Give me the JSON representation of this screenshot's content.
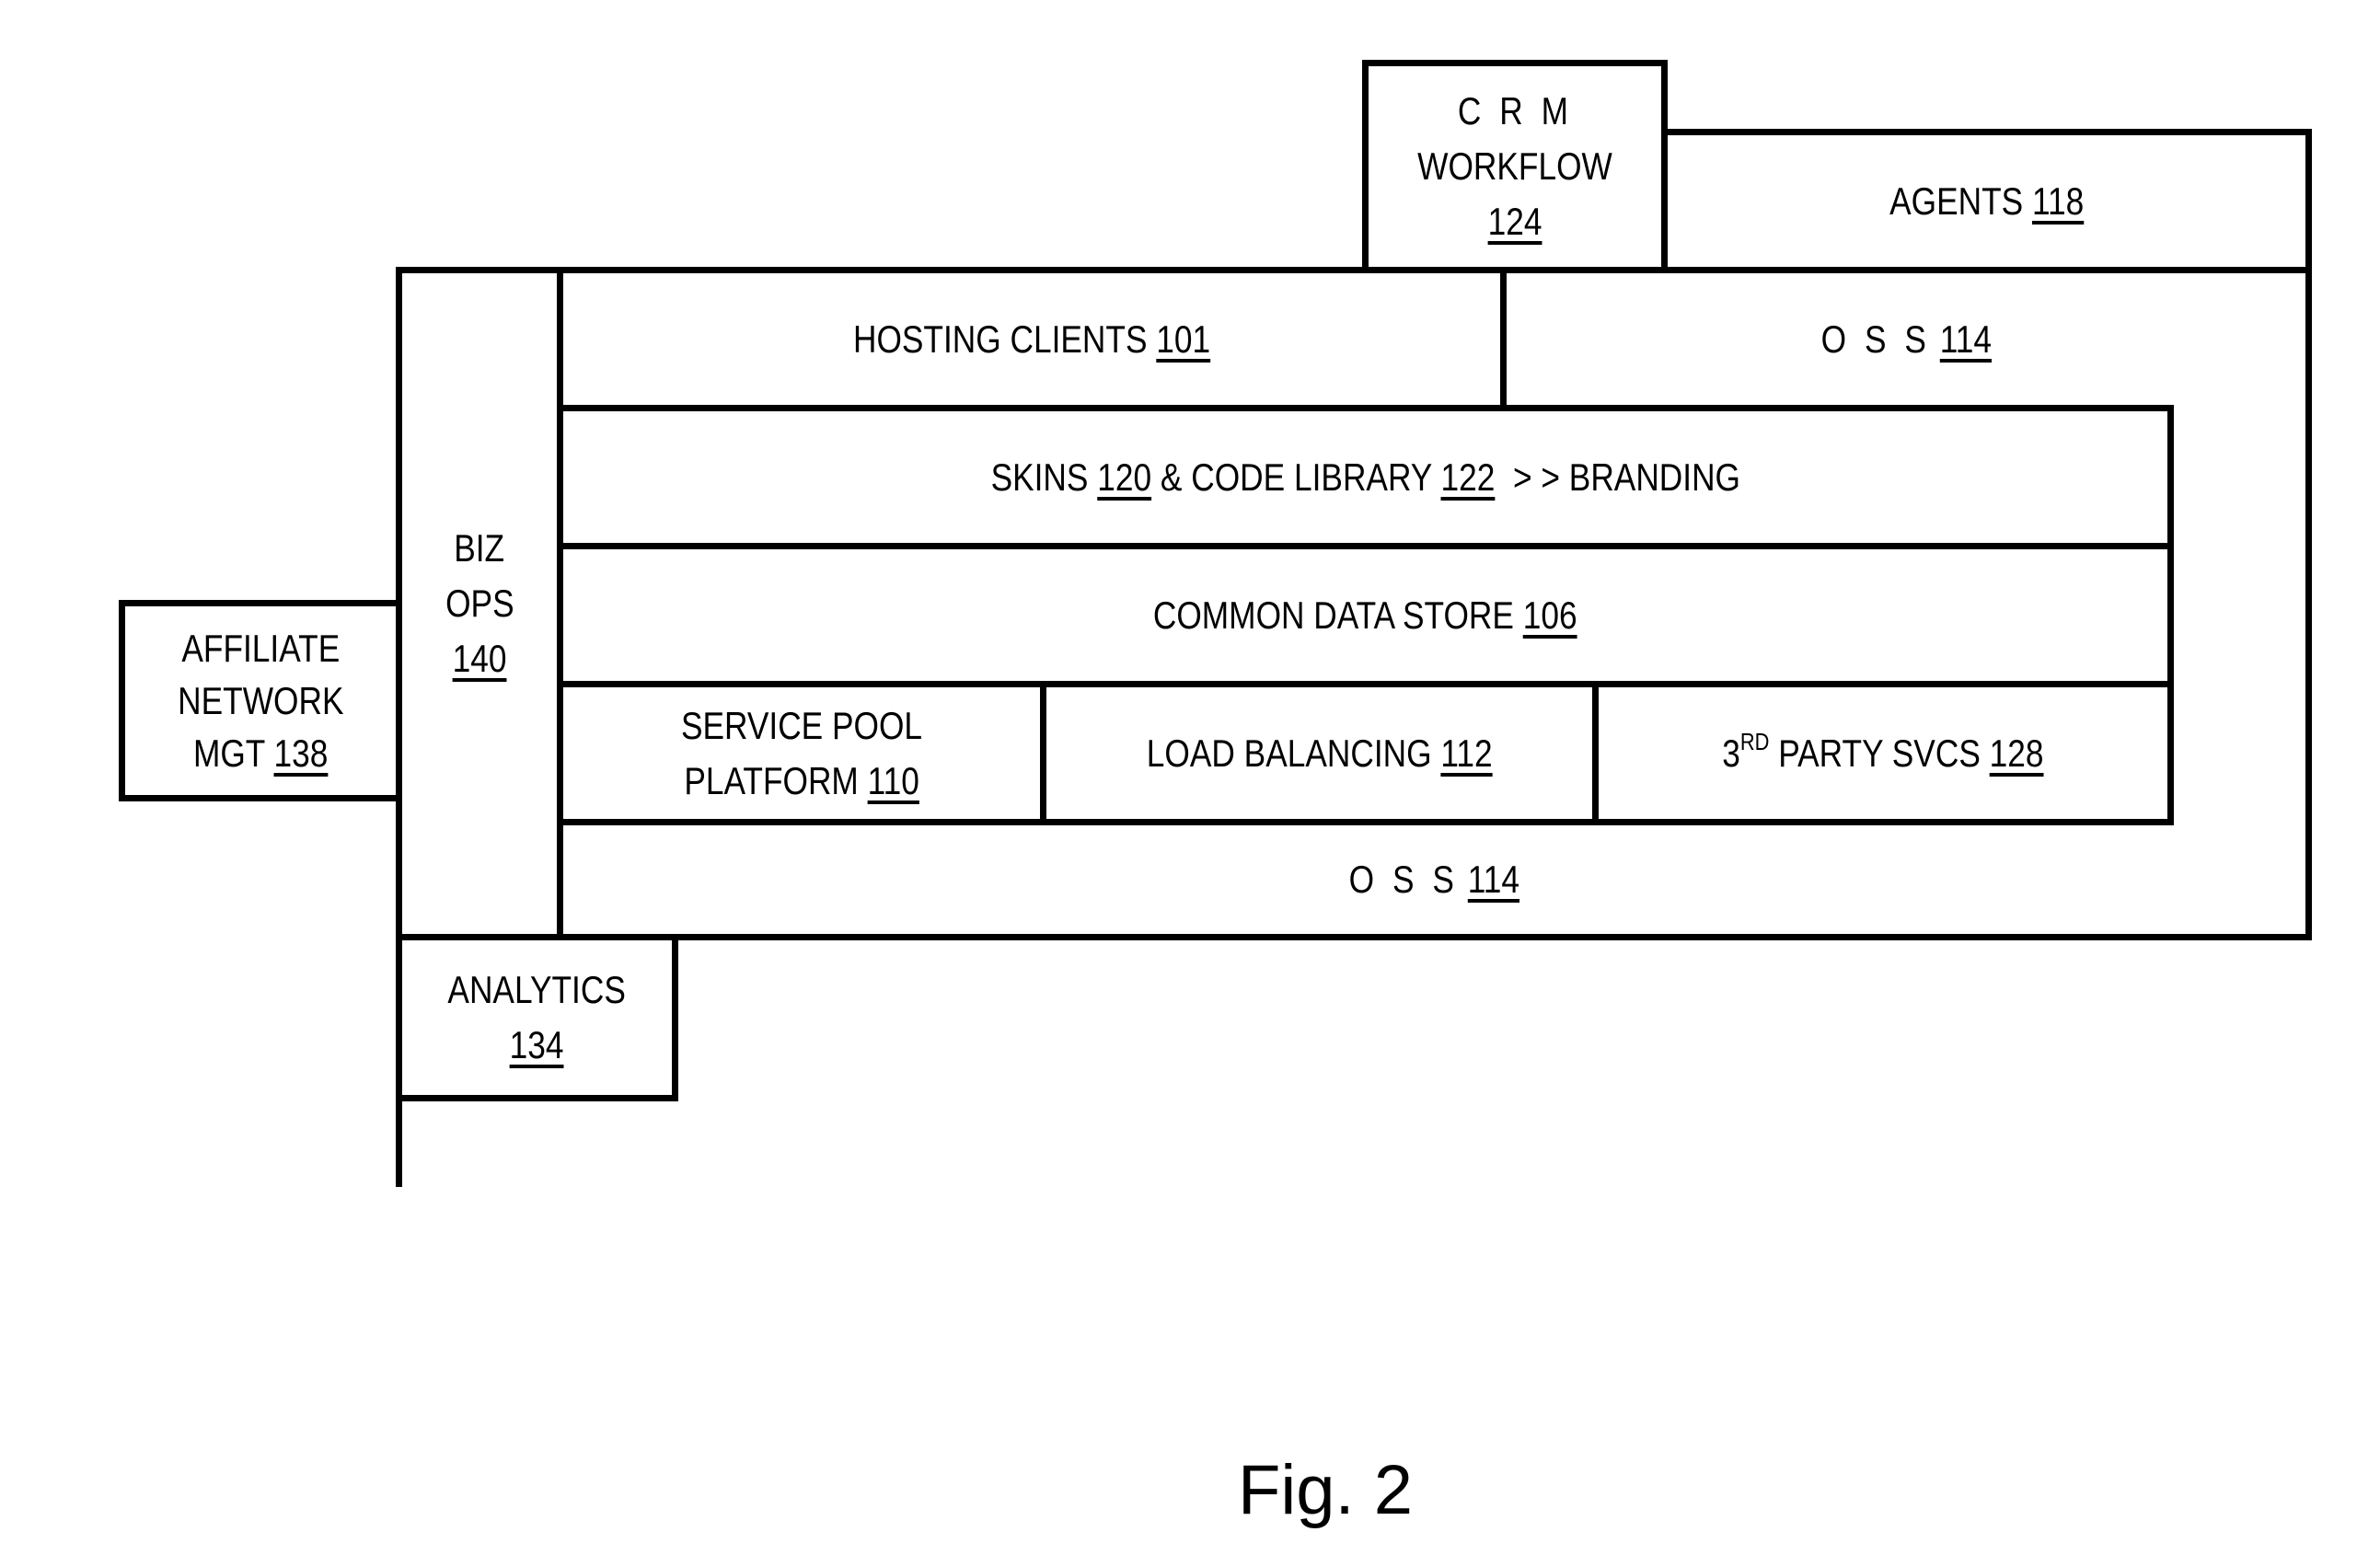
{
  "figure": {
    "caption": "Fig. 2",
    "line_color": "#000000",
    "background": "#ffffff"
  },
  "blocks": {
    "crm_workflow": {
      "lines": [
        "C R M",
        "WORKFLOW"
      ],
      "ref": "124"
    },
    "agents": {
      "text": "AGENTS",
      "ref": "118"
    },
    "hosting_clients": {
      "text": "HOSTING CLIENTS",
      "ref": "101"
    },
    "oss_top": {
      "text": "O S S",
      "ref": "114"
    },
    "skins_branding": {
      "pre": "SKINS",
      "ref1": "120",
      "mid": "& CODE LIBRARY",
      "ref2": "122",
      "post": "> > BRANDING"
    },
    "common_data_store": {
      "text": "COMMON DATA STORE",
      "ref": "106"
    },
    "service_pool_platform": {
      "line1": "SERVICE POOL",
      "line2": "PLATFORM",
      "ref": "110"
    },
    "load_balancing": {
      "text": "LOAD BALANCING",
      "ref": "112"
    },
    "third_party_svcs": {
      "num": "3",
      "sup": "RD",
      "text": "PARTY SVCS",
      "ref": "128"
    },
    "oss_bottom": {
      "text": "O S S",
      "ref": "114"
    },
    "biz_ops": {
      "lines": [
        "BIZ",
        "OPS"
      ],
      "ref": "140"
    },
    "affiliate_network_mgt": {
      "lines": [
        "AFFILIATE",
        "NETWORK"
      ],
      "last": "MGT",
      "ref": "138"
    },
    "analytics": {
      "text": "ANALYTICS",
      "ref": "134"
    }
  }
}
